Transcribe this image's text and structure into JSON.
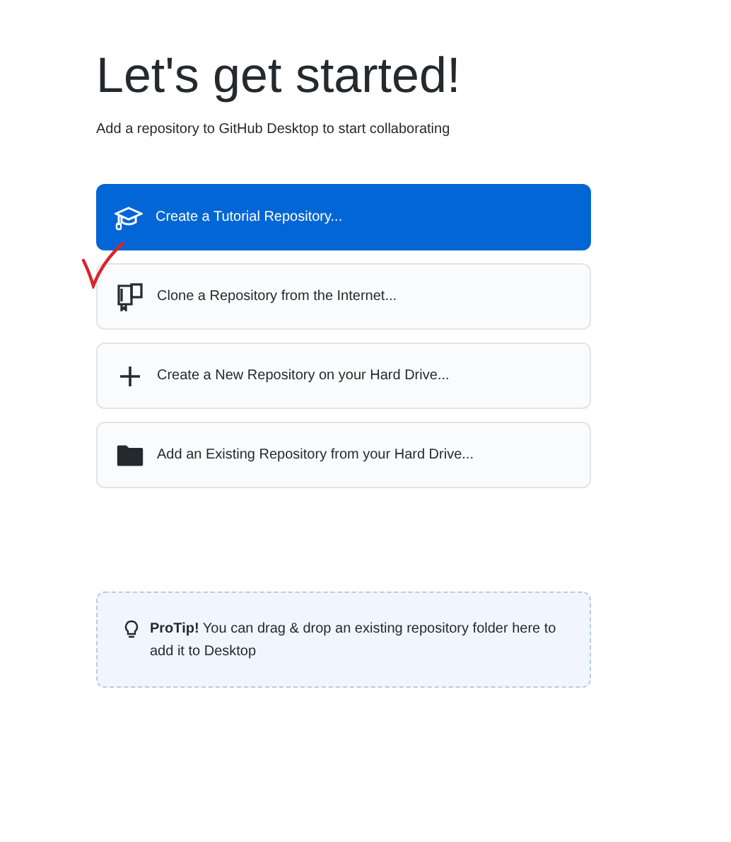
{
  "title": "Let's get started!",
  "subtitle": "Add a repository to GitHub Desktop to start collaborating",
  "options": [
    {
      "kind": "tutorial",
      "label": "Create a Tutorial Repository...",
      "selected": true
    },
    {
      "kind": "clone",
      "label": "Clone a Repository from the Internet...",
      "selected": false
    },
    {
      "kind": "create",
      "label": "Create a New Repository on your Hard Drive...",
      "selected": false
    },
    {
      "kind": "add",
      "label": "Add an Existing Repository from your Hard Drive...",
      "selected": false
    }
  ],
  "tip": "**ProTip!** You can drag & drop an existing repository folder here to add it to Desktop"
}
